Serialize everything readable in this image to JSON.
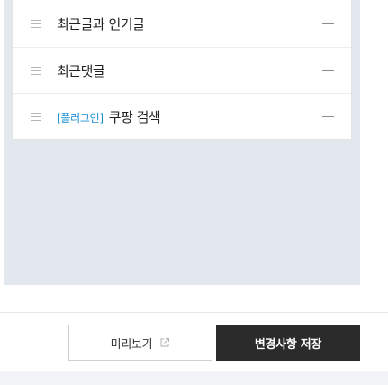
{
  "menu_list": {
    "items": [
      {
        "tag": "",
        "label": "최근글과 인기글"
      },
      {
        "tag": "",
        "label": "최근댓글"
      },
      {
        "tag": "[플러그인]",
        "label": "쿠팡 검색"
      }
    ]
  },
  "footer": {
    "preview_label": "미리보기",
    "save_label": "변경사항 저장"
  },
  "colors": {
    "tag_blue": "#1a8fd6",
    "save_button_bg": "#2b2b2b",
    "canvas_bg": "#e3e8ef"
  }
}
